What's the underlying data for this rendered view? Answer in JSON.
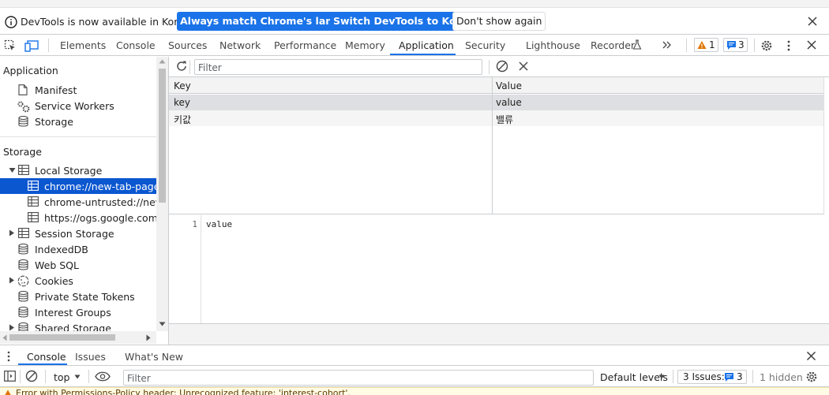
{
  "infobar": {
    "message": "DevTools is now available in Korean!",
    "btn_match": "Always match Chrome's language",
    "btn_switch": "Switch DevTools to Korean",
    "btn_dismiss": "Don't show again"
  },
  "tabs": {
    "elements": "Elements",
    "console": "Console",
    "sources": "Sources",
    "network": "Network",
    "performance": "Performance",
    "memory": "Memory",
    "application": "Application",
    "security": "Security",
    "lighthouse": "Lighthouse",
    "recorder": "Recorder",
    "warnings_count": "1",
    "messages_count": "3"
  },
  "sidebar": {
    "application_header": "Application",
    "manifest": "Manifest",
    "service_workers": "Service Workers",
    "storage_item": "Storage",
    "storage_header": "Storage",
    "local_storage": "Local Storage",
    "ls_origins": [
      "chrome://new-tab-page/",
      "chrome-untrusted://new-tab-page/",
      "https://ogs.google.com/"
    ],
    "session_storage": "Session Storage",
    "indexeddb": "IndexedDB",
    "websql": "Web SQL",
    "cookies": "Cookies",
    "private_state_tokens": "Private State Tokens",
    "interest_groups": "Interest Groups",
    "shared_storage": "Shared Storage"
  },
  "storage_view": {
    "filter_placeholder": "Filter",
    "columns": {
      "key": "Key",
      "value": "Value"
    },
    "rows": [
      {
        "key": "key",
        "value": "value"
      },
      {
        "key": "키값",
        "value": "밸류"
      }
    ],
    "preview_line_number": "1",
    "preview_text": "value"
  },
  "drawer": {
    "tab_console": "Console",
    "tab_issues": "Issues",
    "tab_whats_new": "What's New",
    "context": "top",
    "filter_placeholder": "Filter",
    "levels": "Default levels",
    "issues_label": "3 Issues:",
    "issues_count": "3",
    "hidden": "1 hidden"
  },
  "warning_strip": {
    "text": "Error with Permissions-Policy header: Unrecognized feature: 'interest-cohort'."
  },
  "colors": {
    "accent": "#1a73e8",
    "selected": "#0b57d0",
    "warning": "#e37400"
  }
}
